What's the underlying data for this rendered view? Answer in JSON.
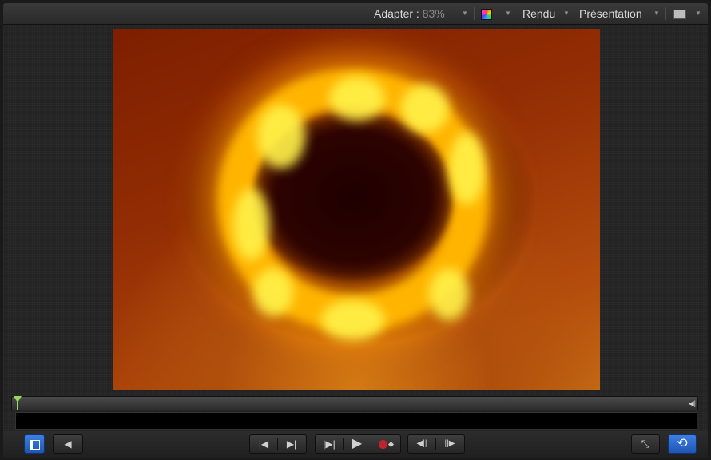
{
  "toolbar": {
    "fit_label": "Adapter :",
    "zoom_value": "83%",
    "render_label": "Rendu",
    "view_label": "Présentation"
  },
  "icons": {
    "color_channels": "color-wheel-icon",
    "layout": "layout-icon",
    "dropdown": "chevron-down-icon"
  },
  "colors": {
    "accent_blue": "#2f6fd6",
    "playhead_green": "#9ad65a",
    "record_red": "#c0232b"
  },
  "glyphs": {
    "dropdown": "▼",
    "go_to_start": "|◀",
    "go_to_end": "▶|",
    "play_from_start": "|▶|",
    "play": "▶",
    "prev_frame": "◀||",
    "next_frame": "||▶",
    "audio": "◀",
    "fullscreen": "⤡",
    "loop": "⟲",
    "out_point": "◀|"
  }
}
